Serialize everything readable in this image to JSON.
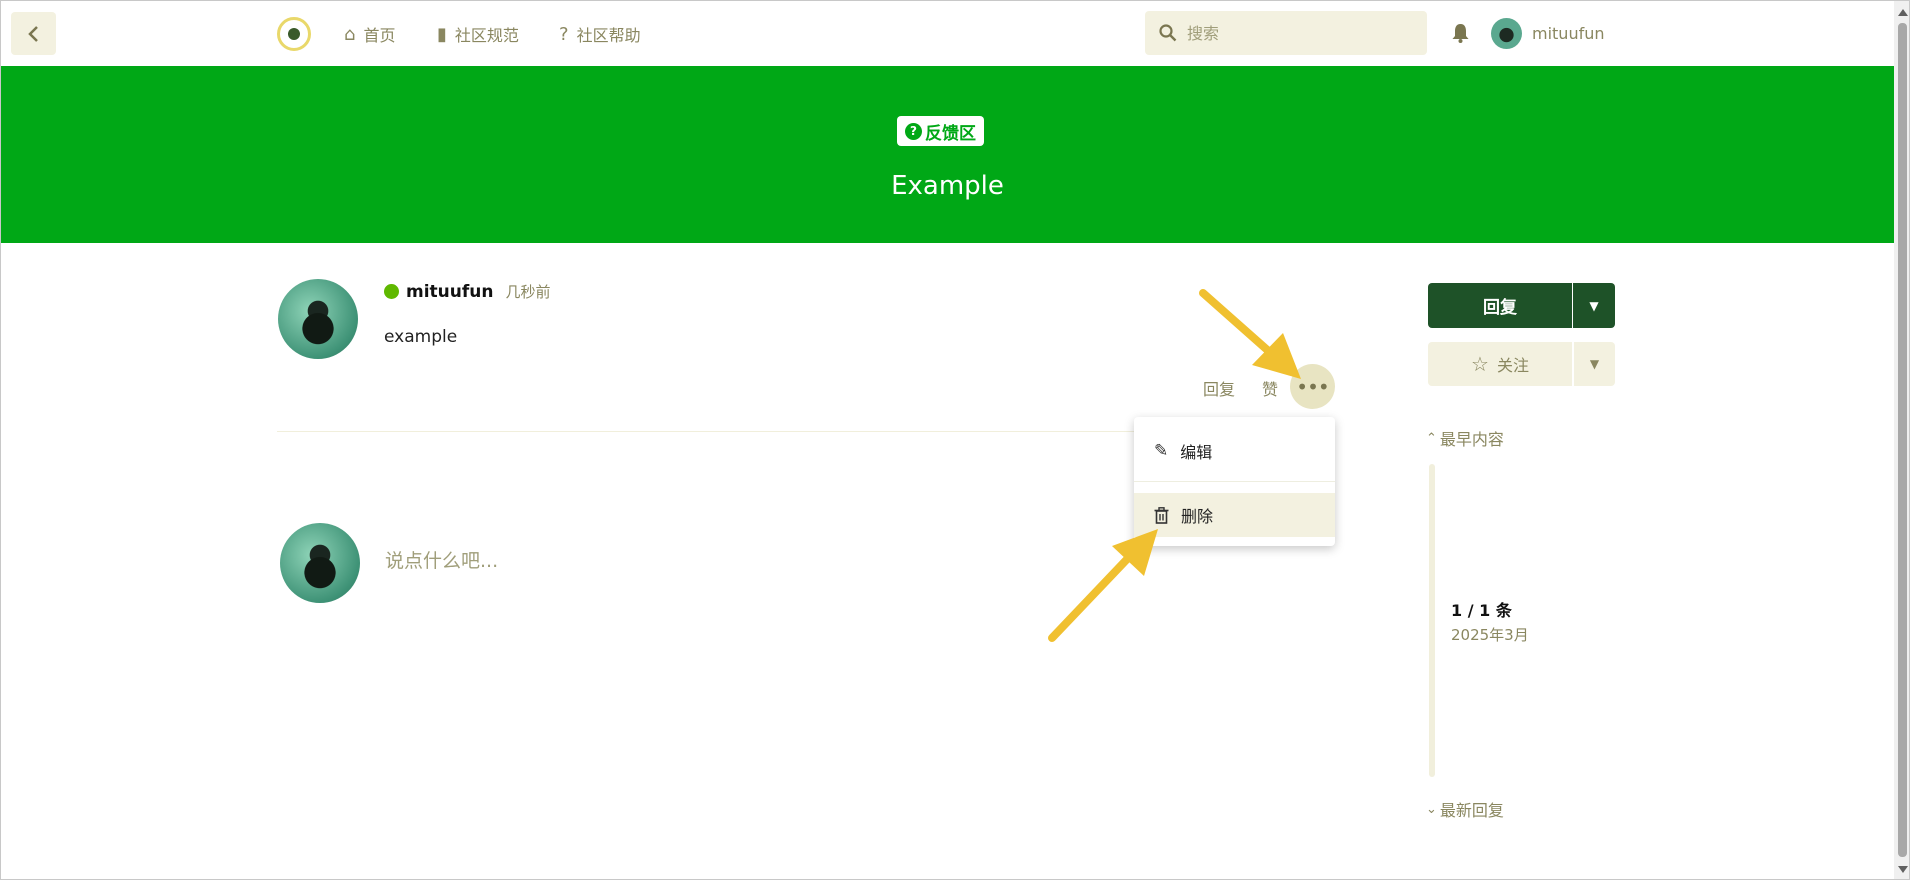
{
  "header": {
    "nav": [
      {
        "label": "首页",
        "icon": "home-icon"
      },
      {
        "label": "社区规范",
        "icon": "book-icon"
      },
      {
        "label": "社区帮助",
        "icon": "question-circle-icon"
      }
    ],
    "search_placeholder": "搜索",
    "username": "mituufun"
  },
  "hero": {
    "tag": "反馈区",
    "title": "Example",
    "color": "#00a816"
  },
  "post": {
    "author": "mituufun",
    "time": "几秒前",
    "body": "example",
    "actions": {
      "reply": "回复",
      "like": "赞"
    }
  },
  "menu": {
    "edit": "编辑",
    "delete": "删除"
  },
  "composer": {
    "placeholder": "说点什么吧..."
  },
  "sidebar": {
    "reply_button": "回复",
    "follow_button": "关注",
    "earliest": "最早内容",
    "latest": "最新回复",
    "progress": "1 / 1 条",
    "date": "2025年3月"
  },
  "colors": {
    "accent": "#00a816",
    "primary_button": "#1e5228",
    "annotation": "#f0c030"
  }
}
